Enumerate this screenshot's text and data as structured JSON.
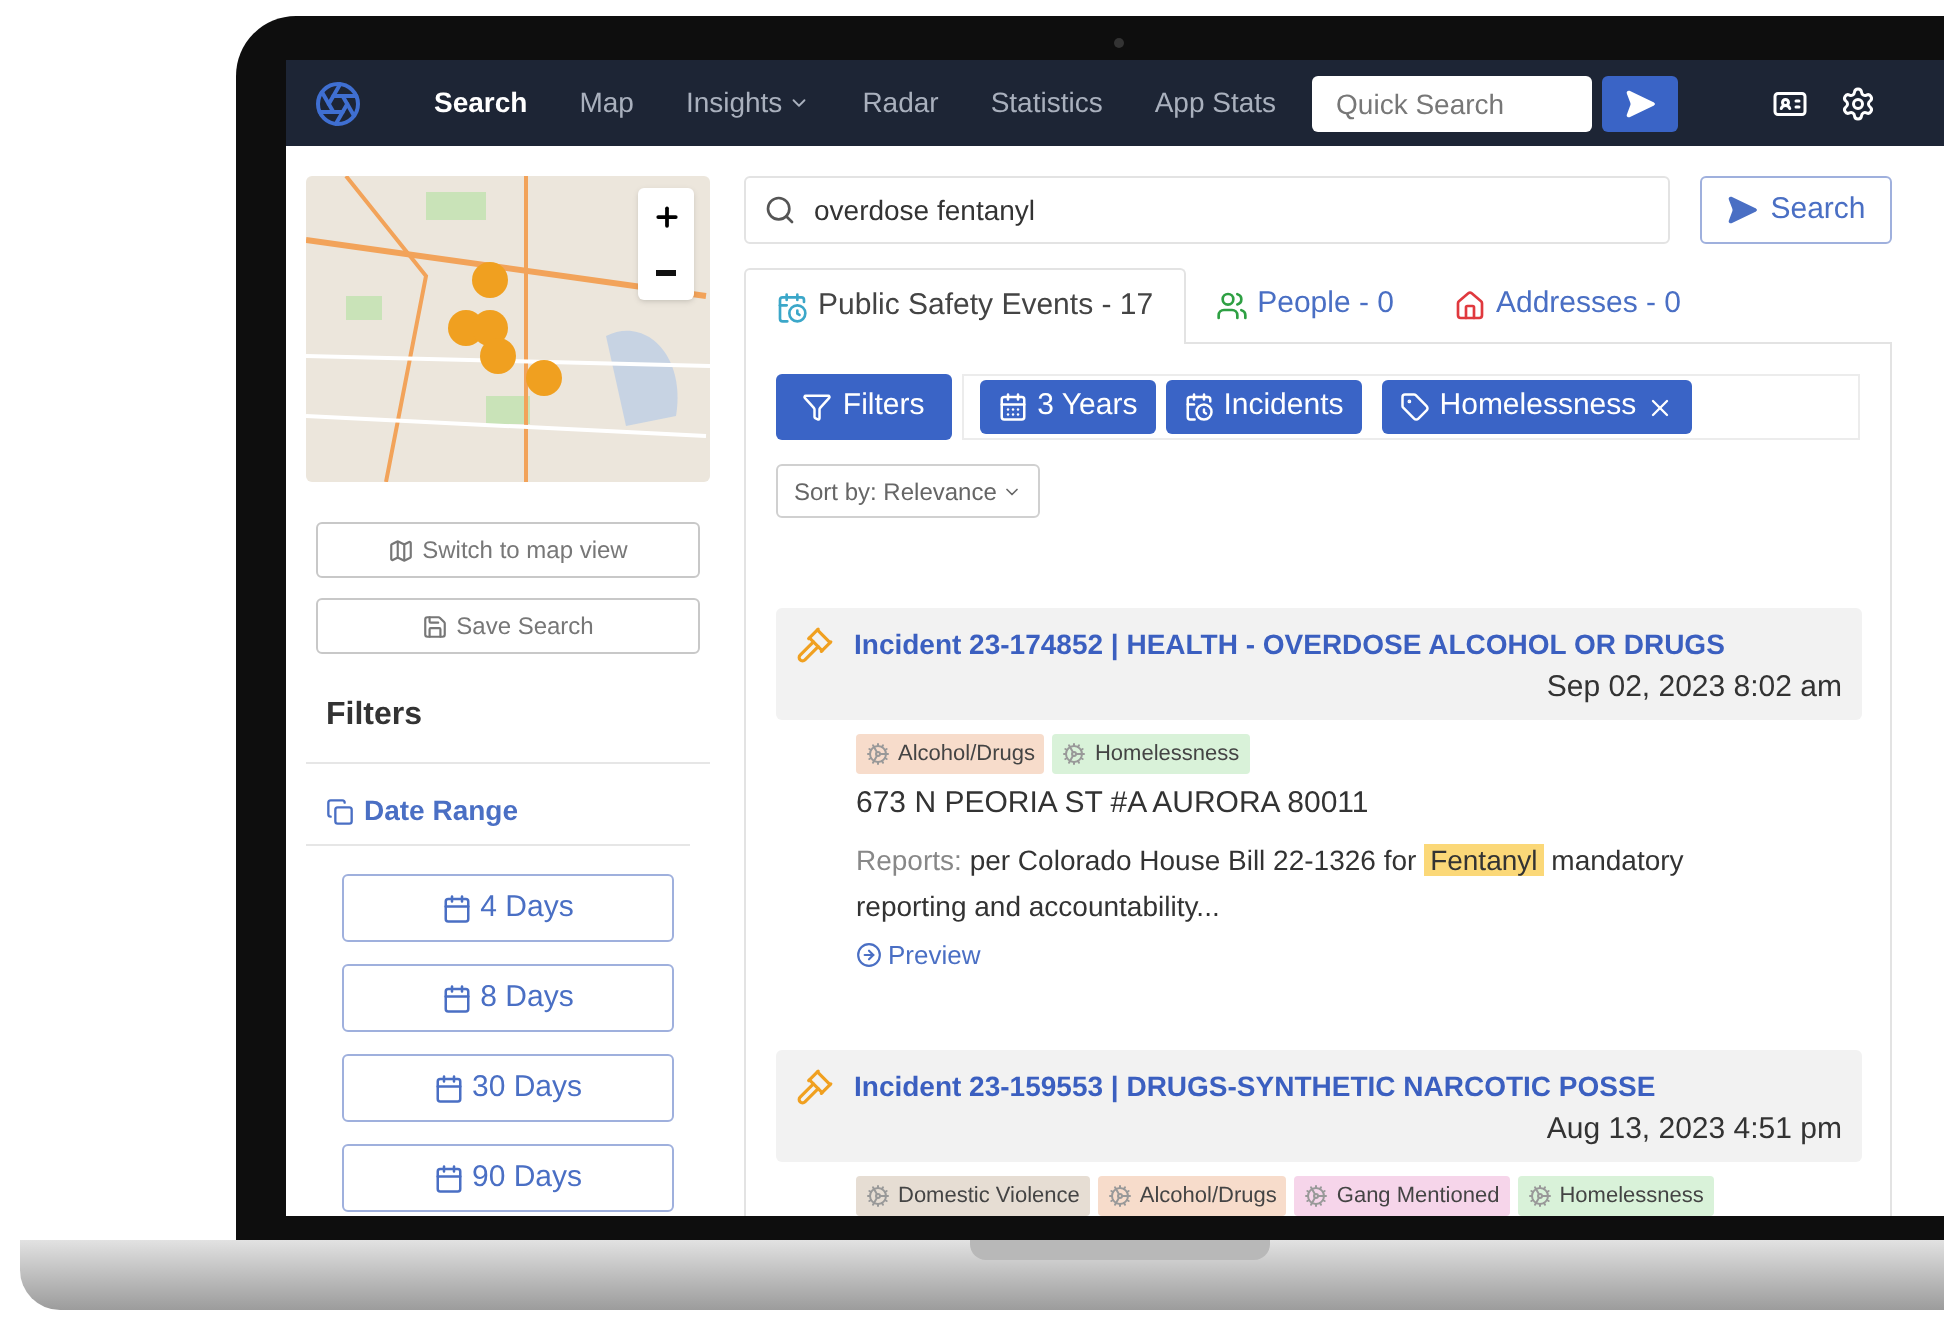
{
  "nav": {
    "items": [
      {
        "label": "Search",
        "selected": true,
        "dropdown": false
      },
      {
        "label": "Map",
        "selected": false,
        "dropdown": false
      },
      {
        "label": "Insights",
        "selected": false,
        "dropdown": true
      },
      {
        "label": "Radar",
        "selected": false,
        "dropdown": false
      },
      {
        "label": "Statistics",
        "selected": false,
        "dropdown": false
      },
      {
        "label": "App Stats",
        "selected": false,
        "dropdown": false
      }
    ],
    "quick_search": {
      "placeholder": "Quick Search"
    }
  },
  "sidebar": {
    "buttons": [
      {
        "label": "Switch to map view",
        "kind": "map"
      },
      {
        "label": "Save Search",
        "kind": "save"
      }
    ],
    "filters_title": "Filters",
    "date_range": {
      "title": "Date Range",
      "options": [
        "4 Days",
        "8 Days",
        "30 Days",
        "90 Days"
      ]
    }
  },
  "search": {
    "value": "overdose fentanyl",
    "button": "Search"
  },
  "tabs": [
    {
      "label": "Public Safety Events - 17",
      "selected": true,
      "kind": "events"
    },
    {
      "label": "People - 0",
      "selected": false,
      "kind": "people"
    },
    {
      "label": "Addresses - 0",
      "selected": false,
      "kind": "addresses"
    }
  ],
  "filter_button": "Filters",
  "chips": [
    {
      "label": "3 Years",
      "kind": "date",
      "removable": false
    },
    {
      "label": "Incidents",
      "kind": "type",
      "removable": false
    },
    {
      "label": "Homelessness",
      "kind": "tag",
      "removable": true
    }
  ],
  "sort": "Sort by: Relevance",
  "results": [
    {
      "title": "Incident 23-174852 | HEALTH - OVERDOSE ALCOHOL OR DRUGS",
      "date": "Sep 02, 2023 8:02 am",
      "tags": [
        {
          "label": "Alcohol/Drugs",
          "color": "#f7dccb"
        },
        {
          "label": "Homelessness",
          "color": "#d9f2d9"
        }
      ],
      "address": "673 N PEORIA ST #A AURORA 80011",
      "report_label": "Reports:",
      "report_before": "per Colorado House Bill 22-1326 for",
      "report_highlight": "Fentanyl",
      "report_after": "mandatory reporting and accountability...",
      "preview": "Preview"
    },
    {
      "title": "Incident 23-159553 | DRUGS-SYNTHETIC NARCOTIC POSSE",
      "date": "Aug 13, 2023 4:51 pm",
      "tags": [
        {
          "label": "Domestic Violence",
          "color": "#e6ddd3"
        },
        {
          "label": "Alcohol/Drugs",
          "color": "#f7dccb"
        },
        {
          "label": "Gang Mentioned",
          "color": "#f6d5ea"
        },
        {
          "label": "Homelessness",
          "color": "#d9f2d9"
        }
      ]
    }
  ]
}
